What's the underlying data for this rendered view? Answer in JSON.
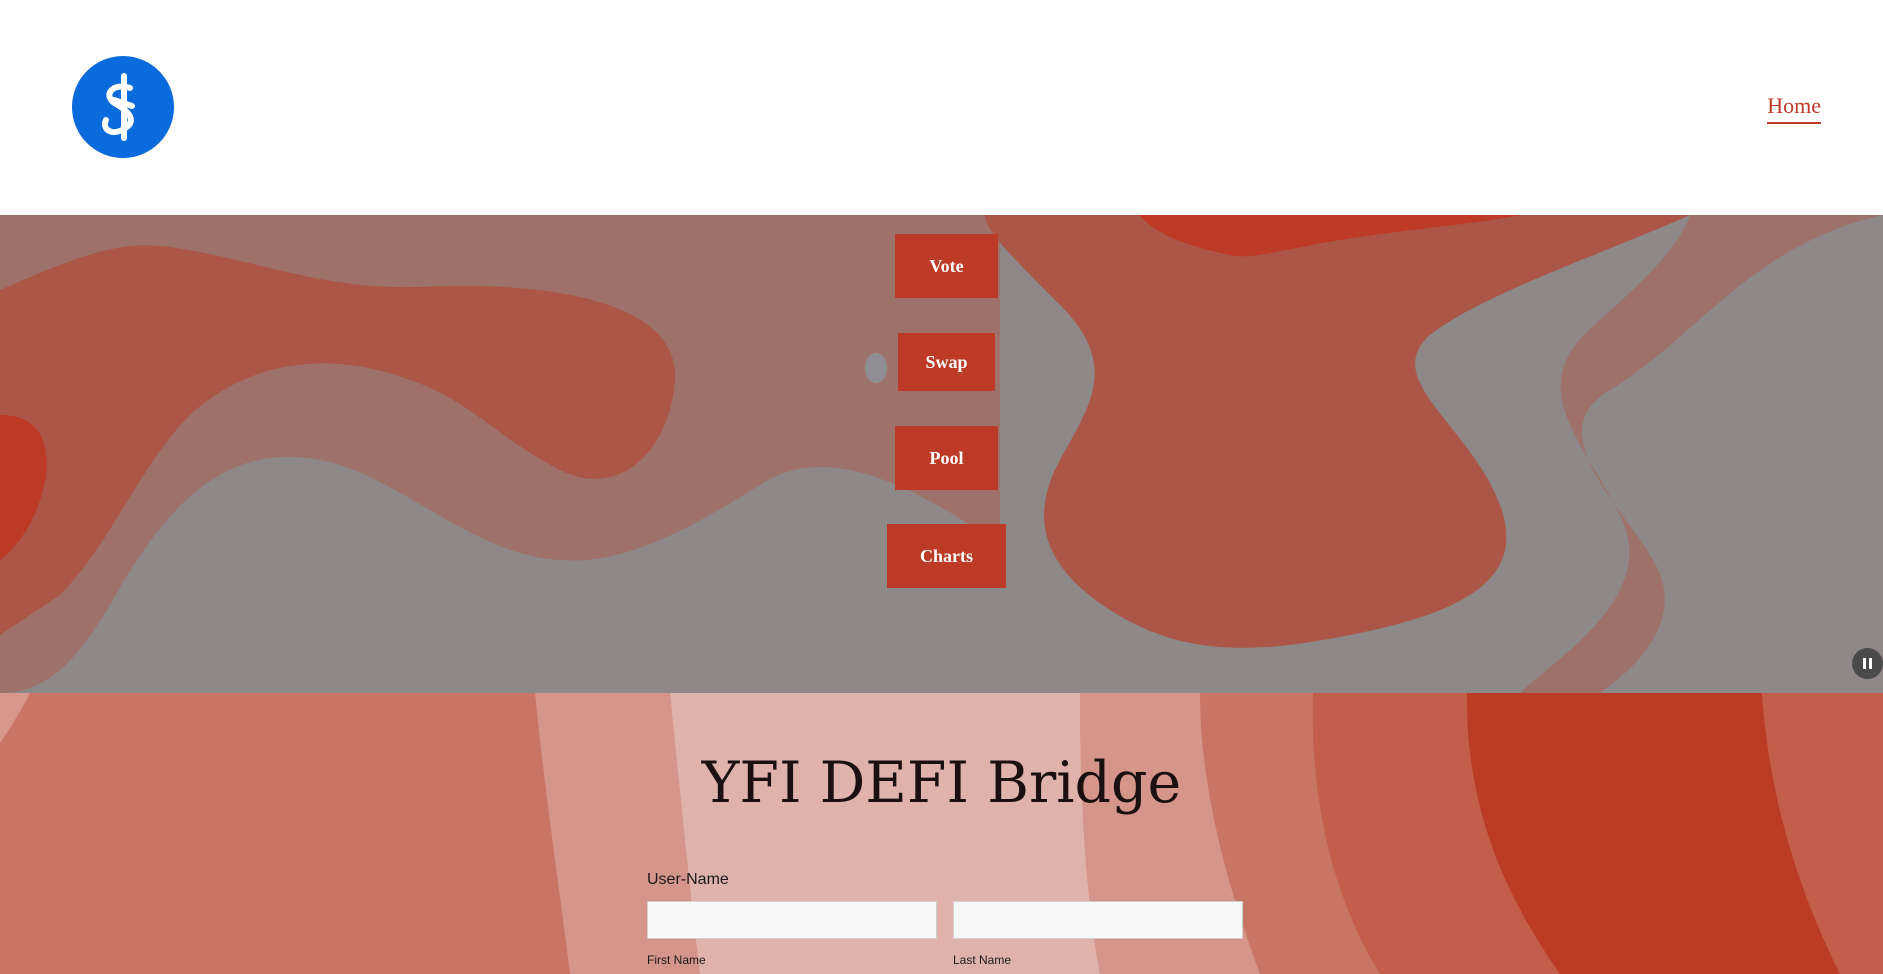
{
  "header": {
    "logo_icon": "yearn-finance-logo-icon",
    "logo_color": "#0a6bdc",
    "nav": {
      "home_label": "Home"
    }
  },
  "hero": {
    "buttons": [
      {
        "label": "Vote"
      },
      {
        "label": "Swap"
      },
      {
        "label": "Pool"
      },
      {
        "label": "Charts"
      }
    ],
    "button_color": "#bd3b26",
    "pause_icon": "pause-icon"
  },
  "bridge": {
    "title": "YFI DEFI Bridge",
    "username_label": "User-Name",
    "first_name": {
      "value": "",
      "label": "First Name"
    },
    "last_name": {
      "value": "",
      "label": "Last Name"
    }
  },
  "colors": {
    "accent": "#c0392b",
    "hero_gray": "#8e8888",
    "hero_mauve": "#9e726a",
    "hero_rust": "#ab5647"
  }
}
